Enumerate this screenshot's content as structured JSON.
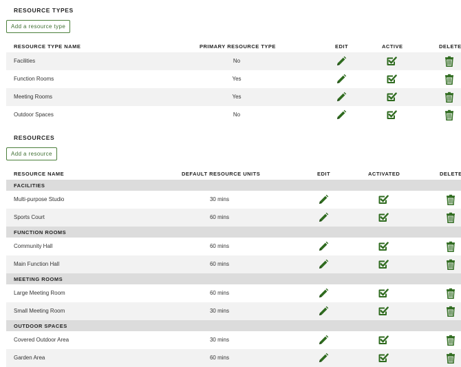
{
  "resource_types": {
    "title": "RESOURCE TYPES",
    "add_button": "Add a resource type",
    "headers": {
      "name": "RESOURCE TYPE NAME",
      "primary": "PRIMARY RESOURCE TYPE",
      "edit": "EDIT",
      "active": "ACTIVE",
      "delete": "DELETE"
    },
    "rows": [
      {
        "name": "Facilities",
        "primary": "No"
      },
      {
        "name": "Function Rooms",
        "primary": "Yes"
      },
      {
        "name": "Meeting Rooms",
        "primary": "Yes"
      },
      {
        "name": "Outdoor Spaces",
        "primary": "No"
      }
    ]
  },
  "resources": {
    "title": "RESOURCES",
    "add_button": "Add a resource",
    "headers": {
      "name": "RESOURCE NAME",
      "units": "DEFAULT RESOURCE UNITS",
      "edit": "EDIT",
      "activated": "ACTIVATED",
      "delete": "DELETE"
    },
    "groups": [
      {
        "title": "FACILITIES",
        "rows": [
          {
            "name": "Multi-purpose Studio",
            "units": "30 mins"
          },
          {
            "name": "Sports Court",
            "units": "60 mins"
          }
        ]
      },
      {
        "title": "FUNCTION ROOMS",
        "rows": [
          {
            "name": "Community Hall",
            "units": "60 mins"
          },
          {
            "name": "Main Function Hall",
            "units": "60 mins"
          }
        ]
      },
      {
        "title": "MEETING ROOMS",
        "rows": [
          {
            "name": "Large Meeting Room",
            "units": "60 mins"
          },
          {
            "name": "Small Meeting Room",
            "units": "30 mins"
          }
        ]
      },
      {
        "title": "OUTDOOR SPACES",
        "rows": [
          {
            "name": "Covered Outdoor Area",
            "units": "30 mins"
          },
          {
            "name": "Garden Area",
            "units": "60 mins"
          }
        ]
      }
    ]
  },
  "icons": {
    "edit": "pencil-icon",
    "active": "check-square-icon",
    "delete": "trash-icon"
  },
  "colors": {
    "accent": "#3f6f32",
    "icon": "#2f6b1f",
    "row_alt": "#f2f2f2",
    "group_bg": "#dcdcdc"
  }
}
